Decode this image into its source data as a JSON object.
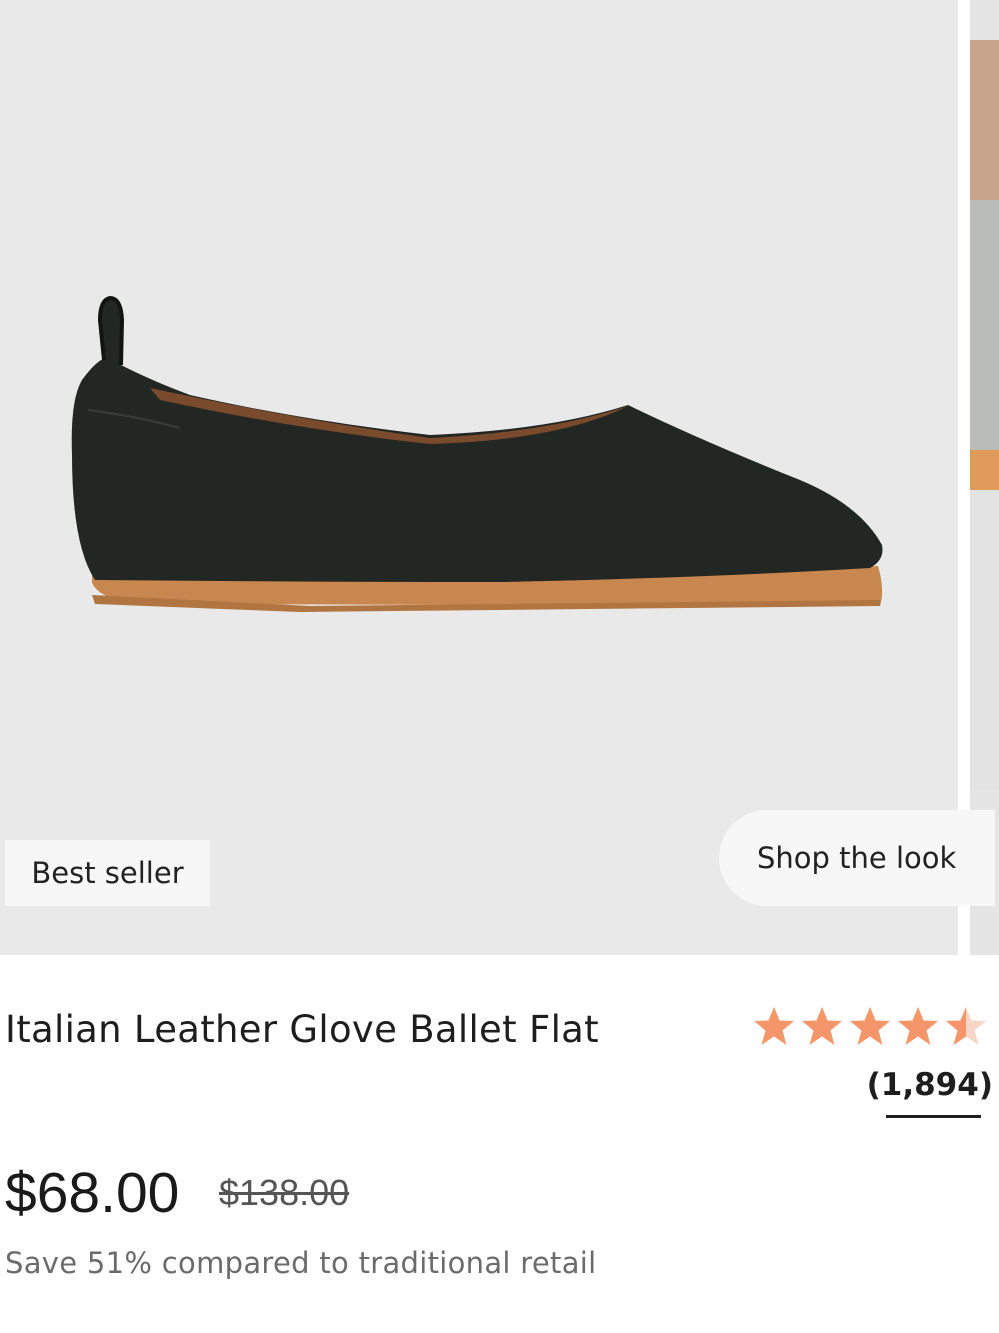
{
  "product": {
    "badge": "Best seller",
    "shop_the_look": "Shop the look",
    "title": "Italian Leather Glove Ballet Flat",
    "rating": 4.5,
    "rating_max": 5,
    "review_count": "(1,894)",
    "price": "$68.00",
    "original_price": "$138.00",
    "savings_text": "Save 51% compared to traditional retail"
  },
  "colors": {
    "image_background": "#e9e9e9",
    "star_color": "#f4956a",
    "shoe_color": "#222622",
    "sole_color": "#c8874e"
  },
  "icons": {
    "star": "star-icon"
  }
}
